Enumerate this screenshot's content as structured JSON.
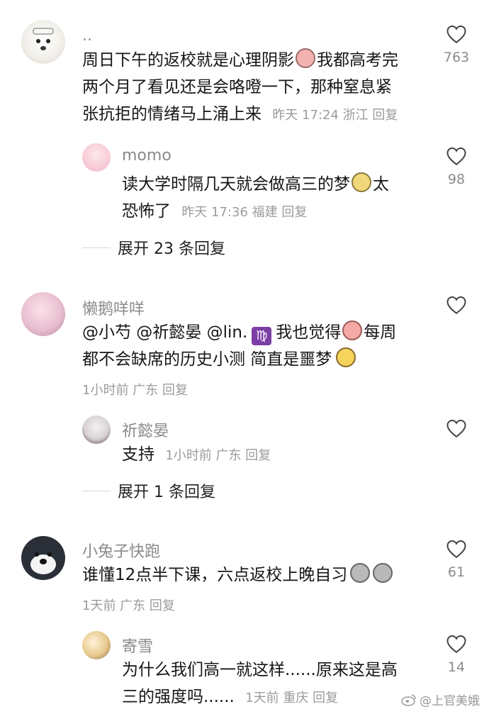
{
  "comments": [
    {
      "user": "..",
      "line1": "周日下午的返校就是心理阴影",
      "line1b": "我都高考完",
      "line2": "两个月了看见还是会咯噔一下，那种窒息紧",
      "line3": "张抗拒的情绪马上涌上来",
      "meta": "昨天 17:24 浙江 回复",
      "likes": "763",
      "replies": [
        {
          "user": "momo",
          "line1": "读大学时隔几天就会做高三的梦",
          "line1b": "太",
          "line2": "恐怖了",
          "meta": "昨天 17:36 福建 回复",
          "likes": "98"
        }
      ],
      "expand": "展开 23 条回复"
    },
    {
      "user": "懒鹅咩咩",
      "line1": "@小芍 @祈懿晏 @lin.",
      "line1b": "我也觉得",
      "line1c": "每周",
      "line2": "都不会缺席的历史小测 简直是噩梦",
      "meta": "1小时前 广东 回复",
      "likes": "",
      "replies": [
        {
          "user": "祈懿晏",
          "line1": "支持",
          "meta": "1小时前 广东 回复",
          "likes": ""
        }
      ],
      "expand": "展开 1 条回复"
    },
    {
      "user": "小兔子快跑",
      "line1": "谁懂12点半下课，六点返校上晚自习",
      "meta": "1天前 广东 回复",
      "likes": "61",
      "replies": [
        {
          "user": "寄雪",
          "line1": "为什么我们高一就这样......原来这是高",
          "line2": "三的强度吗......",
          "meta": "1天前 重庆 回复",
          "likes": "14"
        }
      ]
    }
  ],
  "watermark": "@上官美娥",
  "zodiac": "♍"
}
